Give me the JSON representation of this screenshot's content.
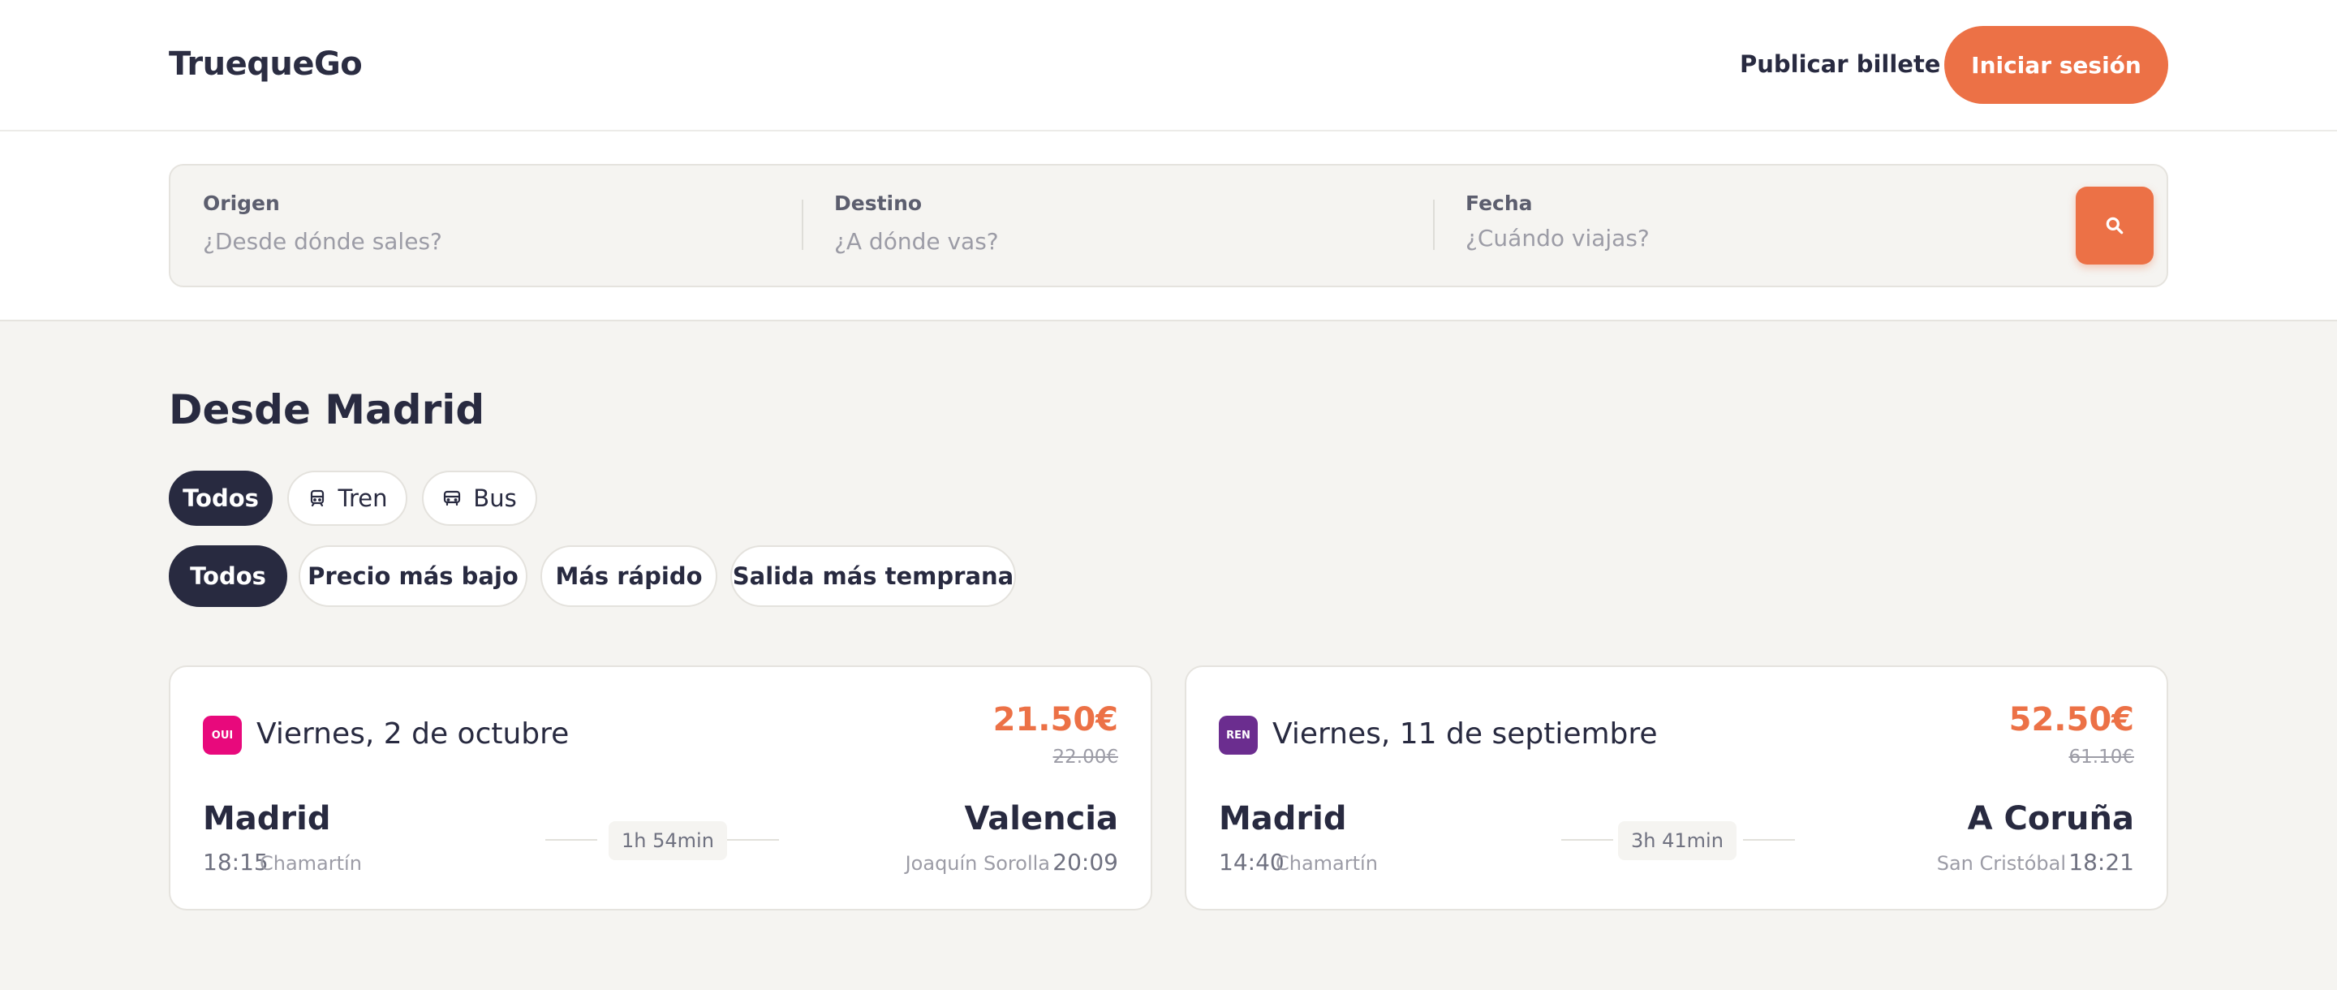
{
  "header": {
    "logo": "TruequeGo",
    "publish_label": "Publicar billete",
    "login_label": "Iniciar sesión"
  },
  "search": {
    "origin": {
      "label": "Origen",
      "placeholder": "¿Desde dónde sales?",
      "value": ""
    },
    "destination": {
      "label": "Destino",
      "placeholder": "¿A dónde vas?",
      "value": ""
    },
    "date": {
      "label": "Fecha",
      "placeholder": "¿Cuándo viajas?",
      "value": ""
    },
    "button_icon": "search-icon"
  },
  "main": {
    "title": "Desde Madrid",
    "transport_filters": [
      {
        "label": "Todos",
        "icon": "",
        "active": true
      },
      {
        "label": "Tren",
        "icon": "train-icon",
        "active": false
      },
      {
        "label": "Bus",
        "icon": "bus-icon",
        "active": false
      }
    ],
    "sort_filters": [
      {
        "label": "Todos",
        "active": true
      },
      {
        "label": "Precio más bajo",
        "active": false
      },
      {
        "label": "Más rápido",
        "active": false
      },
      {
        "label": "Salida más temprana",
        "active": false
      }
    ]
  },
  "trips": [
    {
      "operator_badge": "OUI",
      "operator_color": "#e8097c",
      "date": "Viernes, 2 de octubre",
      "price": "21.50€",
      "old_price": "22.00€",
      "origin_city": "Madrid",
      "departure_time": "18:15",
      "origin_station": "Chamartín",
      "duration": "1h 54min",
      "destination_city": "Valencia",
      "destination_station": "Joaquín Sorolla",
      "arrival_time": "20:09"
    },
    {
      "operator_badge": "REN",
      "operator_color": "#6b2d8f",
      "date": "Viernes, 11 de septiembre",
      "price": "52.50€",
      "old_price": "61.10€",
      "origin_city": "Madrid",
      "departure_time": "14:40",
      "origin_station": "Chamartín",
      "duration": "3h 41min",
      "destination_city": "A Coruña",
      "destination_station": "San Cristóbal",
      "arrival_time": "18:21"
    }
  ],
  "colors": {
    "accent": "#ec7146",
    "dark": "#282a40",
    "background": "#f5f4f1"
  }
}
